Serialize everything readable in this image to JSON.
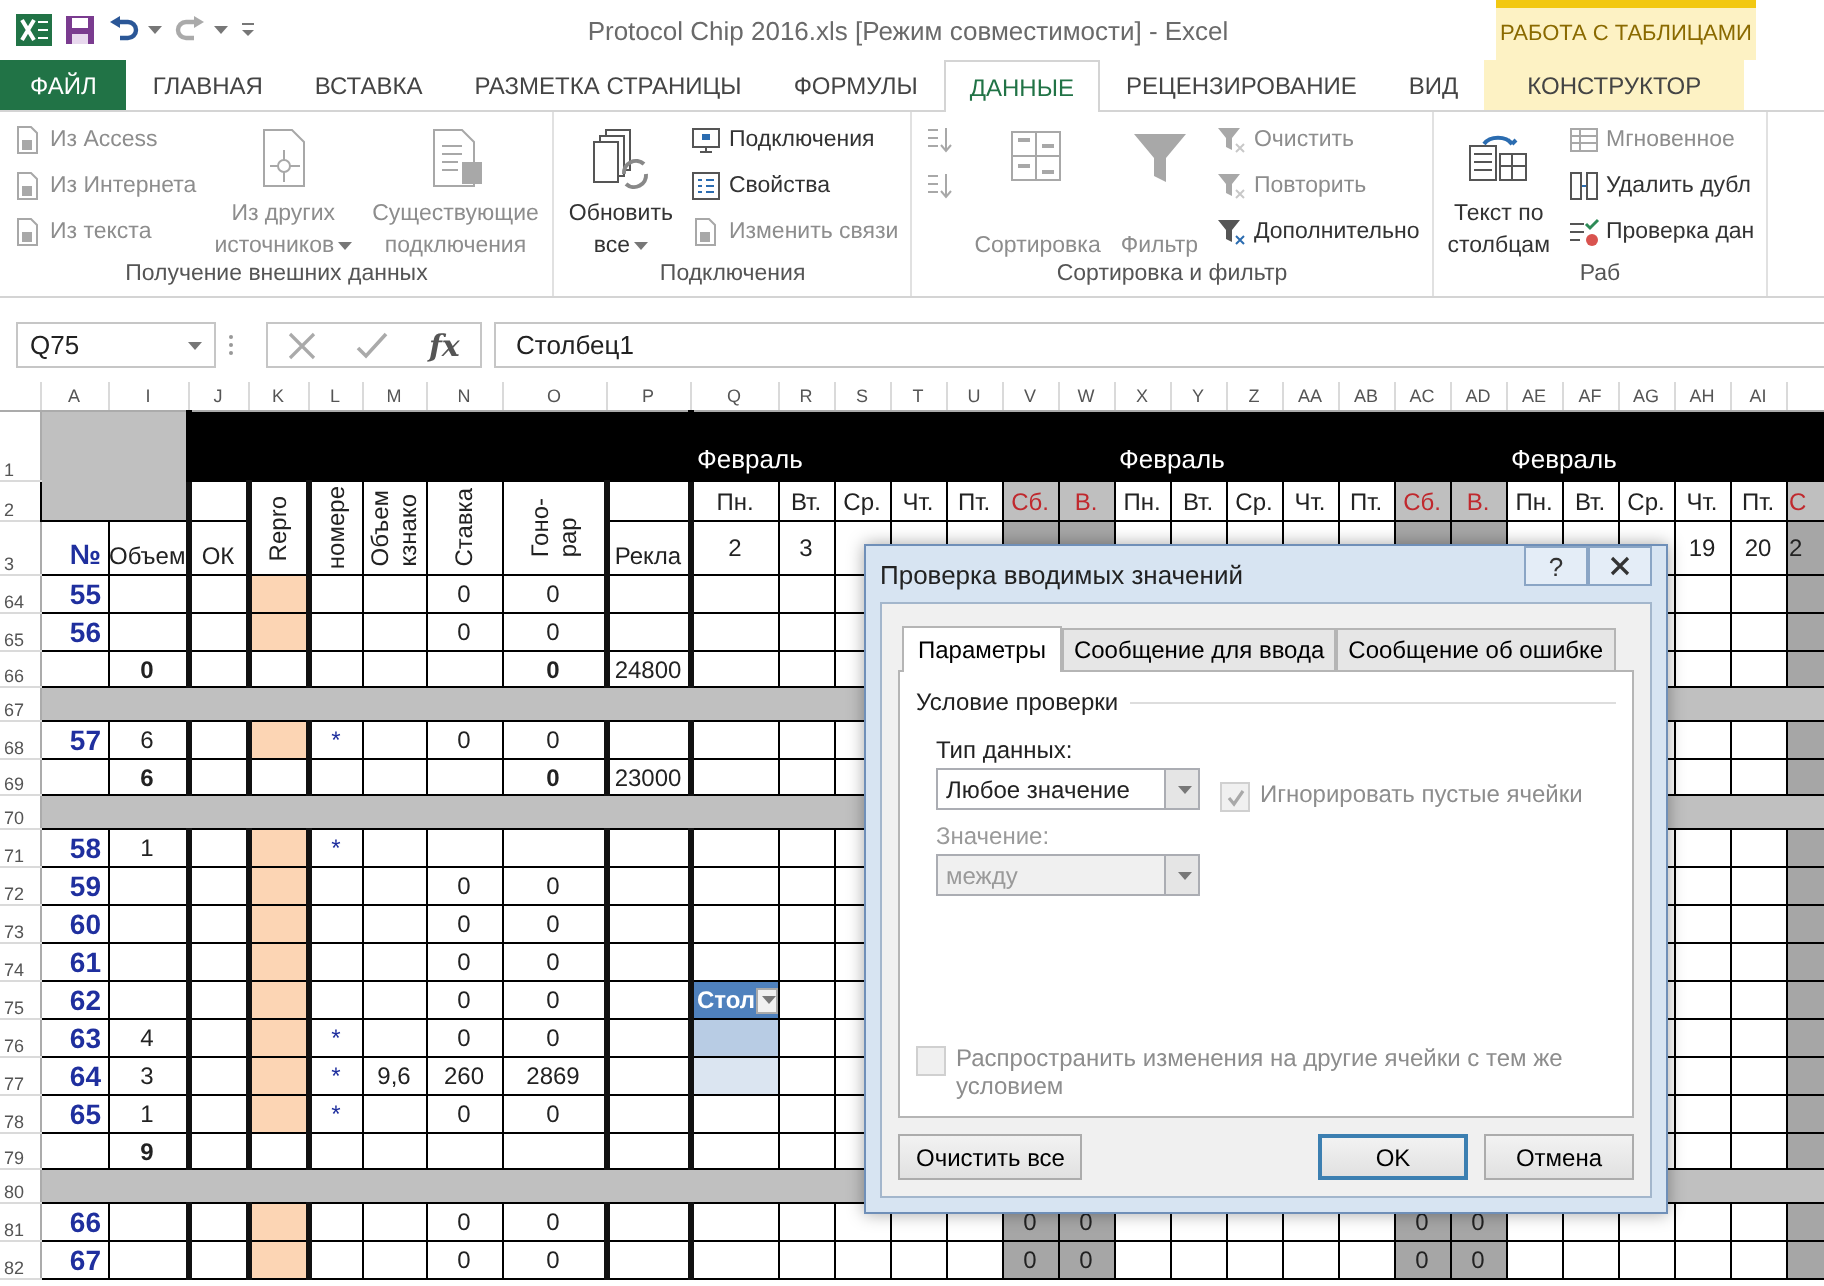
{
  "title_bar": {
    "title": "Protocol Chip 2016.xls  [Режим совместимости] - Excel",
    "context_group": "РАБОТА С ТАБЛИЦАМИ"
  },
  "ribbon_tabs": [
    {
      "label": "ФАЙЛ",
      "kind": "file",
      "selected": false
    },
    {
      "label": "ГЛАВНАЯ",
      "kind": "normal",
      "selected": false
    },
    {
      "label": "ВСТАВКА",
      "kind": "normal",
      "selected": false
    },
    {
      "label": "РАЗМЕТКА СТРАНИЦЫ",
      "kind": "normal",
      "selected": false
    },
    {
      "label": "ФОРМУЛЫ",
      "kind": "normal",
      "selected": false
    },
    {
      "label": "ДАННЫЕ",
      "kind": "normal",
      "selected": true
    },
    {
      "label": "РЕЦЕНЗИРОВАНИЕ",
      "kind": "normal",
      "selected": false
    },
    {
      "label": "ВИД",
      "kind": "normal",
      "selected": false
    },
    {
      "label": "КОНСТРУКТОР",
      "kind": "contextual",
      "selected": false
    }
  ],
  "ribbon_groups": [
    {
      "label": "Получение внешних данных",
      "columns": [
        {
          "kind": "small",
          "items": [
            {
              "label": "Из Access",
              "disabled": true
            },
            {
              "label": "Из Интернета",
              "disabled": true
            },
            {
              "label": "Из текста",
              "disabled": true
            }
          ]
        },
        {
          "kind": "large",
          "items": [
            {
              "lines": [
                "Из других",
                "источников"
              ],
              "dropdown": true,
              "disabled": true
            }
          ]
        },
        {
          "kind": "large",
          "items": [
            {
              "lines": [
                "Существующие",
                "подключения"
              ],
              "dropdown": false,
              "disabled": true
            }
          ]
        }
      ]
    },
    {
      "label": "Подключения",
      "columns": [
        {
          "kind": "large",
          "items": [
            {
              "lines": [
                "Обновить",
                "все"
              ],
              "dropdown": true,
              "disabled": false
            }
          ]
        },
        {
          "kind": "small",
          "items": [
            {
              "label": "Подключения",
              "disabled": false
            },
            {
              "label": "Свойства",
              "disabled": false
            },
            {
              "label": "Изменить связи",
              "disabled": true
            }
          ]
        }
      ]
    },
    {
      "label": "Сортировка и фильтр",
      "columns": [
        {
          "kind": "icons",
          "items": [
            {
              "disabled": true
            },
            {
              "disabled": true
            }
          ]
        },
        {
          "kind": "large",
          "items": [
            {
              "lines": [
                "Сортировка"
              ],
              "dropdown": false,
              "disabled": true
            }
          ]
        },
        {
          "kind": "large",
          "items": [
            {
              "lines": [
                "Фильтр"
              ],
              "dropdown": false,
              "disabled": true
            }
          ]
        },
        {
          "kind": "small",
          "items": [
            {
              "label": "Очистить",
              "disabled": true
            },
            {
              "label": "Повторить",
              "disabled": true
            },
            {
              "label": "Дополнительно",
              "disabled": false
            }
          ]
        }
      ]
    },
    {
      "label": "Раб",
      "columns": [
        {
          "kind": "large",
          "items": [
            {
              "lines": [
                "Текст по",
                "столбцам"
              ],
              "dropdown": false,
              "disabled": false
            }
          ]
        },
        {
          "kind": "small",
          "items": [
            {
              "label": "Мгновенное",
              "disabled": true
            },
            {
              "label": "Удалить дубл",
              "disabled": false
            },
            {
              "label": "Проверка дан",
              "disabled": false
            }
          ]
        }
      ]
    }
  ],
  "formula_bar": {
    "name_box": "Q75",
    "function_label": "fx",
    "formula": "Столбец1"
  },
  "sheet": {
    "columns": [
      "A",
      "I",
      "J",
      "K",
      "L",
      "M",
      "N",
      "O",
      "P",
      "Q",
      "R",
      "S",
      "T",
      "U",
      "V",
      "W",
      "X",
      "Y",
      "Z",
      "AA",
      "AB",
      "AC",
      "AD",
      "AE",
      "AF",
      "AG",
      "AH",
      "AI"
    ],
    "header_row_numbers": [
      "1",
      "2",
      "3"
    ],
    "left_headers": [
      {
        "kind": "plain",
        "label": "№"
      },
      {
        "kind": "plain",
        "label": "Объем"
      },
      {
        "kind": "plain",
        "label": "ОК"
      },
      {
        "kind": "vertical",
        "lines": [
          "Repro"
        ]
      },
      {
        "kind": "vertical",
        "lines": [
          "номере"
        ]
      },
      {
        "kind": "vertical",
        "lines": [
          "Объем",
          "кзнако"
        ]
      },
      {
        "kind": "vertical",
        "lines": [
          "Ставка"
        ]
      },
      {
        "kind": "vertical",
        "lines": [
          "Гоно-",
          "рар"
        ]
      },
      {
        "kind": "plain",
        "label": "Рекла"
      }
    ],
    "weeks": [
      {
        "month": "Февраль",
        "days": [
          {
            "label": "Пн.",
            "weekend": false,
            "date": "2"
          },
          {
            "label": "Вт.",
            "weekend": false,
            "date": "3"
          },
          {
            "label": "Ср.",
            "weekend": false
          },
          {
            "label": "Чт.",
            "weekend": false
          },
          {
            "label": "Пт.",
            "weekend": false
          },
          {
            "label": "Сб.",
            "weekend": true
          },
          {
            "label": "В.",
            "weekend": true
          }
        ]
      },
      {
        "month": "Февраль",
        "days": [
          {
            "label": "Пн.",
            "weekend": false
          },
          {
            "label": "Вт.",
            "weekend": false
          },
          {
            "label": "Ср.",
            "weekend": false
          },
          {
            "label": "Чт.",
            "weekend": false
          },
          {
            "label": "Пт.",
            "weekend": false
          },
          {
            "label": "Сб.",
            "weekend": true
          },
          {
            "label": "В.",
            "weekend": true
          }
        ]
      },
      {
        "month": "Февраль",
        "days": [
          {
            "label": "Пн.",
            "weekend": false
          },
          {
            "label": "Вт.",
            "weekend": false
          },
          {
            "label": "Ср.",
            "weekend": false
          },
          {
            "label": "Чт.",
            "weekend": false,
            "date": "19"
          },
          {
            "label": "Пт.",
            "weekend": false,
            "date": "20"
          },
          {
            "label": "С",
            "weekend": true,
            "date": "2"
          }
        ]
      }
    ],
    "rows": [
      {
        "number": "64",
        "kind": "data",
        "highlight": true,
        "cells": {
          "A": "55",
          "N": "0",
          "O": "0"
        }
      },
      {
        "number": "65",
        "kind": "data",
        "highlight": true,
        "cells": {
          "A": "56",
          "N": "0",
          "O": "0"
        }
      },
      {
        "number": "66",
        "kind": "total",
        "highlight": false,
        "cells": {
          "I": "0",
          "O": "0",
          "P": "24800"
        }
      },
      {
        "number": "67",
        "kind": "separator"
      },
      {
        "number": "68",
        "kind": "data",
        "highlight": true,
        "cells": {
          "A": "57",
          "I": "6",
          "L": "*",
          "N": "0",
          "O": "0"
        }
      },
      {
        "number": "69",
        "kind": "total",
        "highlight": false,
        "cells": {
          "I": "6",
          "O": "0",
          "P": "23000"
        }
      },
      {
        "number": "70",
        "kind": "separator"
      },
      {
        "number": "71",
        "kind": "data",
        "highlight": true,
        "cells": {
          "A": "58",
          "I": "1",
          "L": "*"
        }
      },
      {
        "number": "72",
        "kind": "data",
        "highlight": true,
        "cells": {
          "A": "59",
          "N": "0",
          "O": "0"
        }
      },
      {
        "number": "73",
        "kind": "data",
        "highlight": true,
        "cells": {
          "A": "60",
          "N": "0",
          "O": "0"
        }
      },
      {
        "number": "74",
        "kind": "data",
        "highlight": true,
        "cells": {
          "A": "61",
          "N": "0",
          "O": "0"
        }
      },
      {
        "number": "75",
        "kind": "data",
        "highlight": true,
        "cells": {
          "A": "62",
          "N": "0",
          "O": "0",
          "Q": "Стол"
        },
        "table_cell": {
          "kind": "header"
        }
      },
      {
        "number": "76",
        "kind": "data",
        "highlight": true,
        "cells": {
          "A": "63",
          "I": "4",
          "L": "*",
          "N": "0",
          "O": "0"
        },
        "table_cell": {
          "kind": "band1"
        }
      },
      {
        "number": "77",
        "kind": "data",
        "highlight": true,
        "cells": {
          "A": "64",
          "I": "3",
          "L": "*",
          "M": "9,6",
          "N": "260",
          "O": "2869"
        },
        "table_cell": {
          "kind": "band2"
        }
      },
      {
        "number": "78",
        "kind": "data",
        "highlight": true,
        "cells": {
          "A": "65",
          "I": "1",
          "L": "*",
          "N": "0",
          "O": "0"
        }
      },
      {
        "number": "79",
        "kind": "total",
        "highlight": false,
        "cells": {
          "I": "9"
        }
      },
      {
        "number": "80",
        "kind": "separator"
      },
      {
        "number": "81",
        "kind": "data",
        "highlight": true,
        "cells": {
          "A": "66",
          "N": "0",
          "O": "0",
          "V": "0",
          "W": "0",
          "AC": "0",
          "AD": "0"
        }
      },
      {
        "number": "82",
        "kind": "data",
        "highlight": true,
        "cells": {
          "A": "67",
          "N": "0",
          "O": "0",
          "V": "0",
          "W": "0",
          "AC": "0",
          "AD": "0"
        }
      }
    ]
  },
  "dialog": {
    "title": "Проверка вводимых значений",
    "help_label": "?",
    "tabs": [
      {
        "label": "Параметры",
        "selected": true
      },
      {
        "label": "Сообщение для ввода",
        "selected": false
      },
      {
        "label": "Сообщение об ошибке",
        "selected": false
      }
    ],
    "section": "Условие проверки",
    "type_label": "Тип данных:",
    "type_value": "Любое значение",
    "ignore_blank": {
      "label": "Игнорировать пустые ячейки",
      "checked": true,
      "disabled": true
    },
    "value_label": "Значение:",
    "value_value": "между",
    "value_disabled": true,
    "apply_all": {
      "label": "Распространить изменения на другие ячейки с тем же условием",
      "checked": false,
      "disabled": true
    },
    "buttons": [
      {
        "label": "Очистить все",
        "kind": "normal"
      },
      {
        "label": "OK",
        "kind": "default"
      },
      {
        "label": "Отмена",
        "kind": "normal"
      }
    ]
  }
}
